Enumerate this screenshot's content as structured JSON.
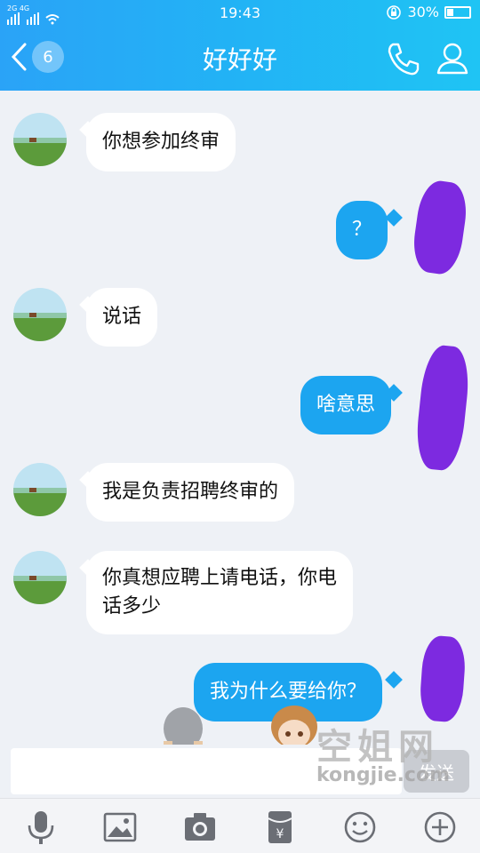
{
  "status": {
    "signal": "2G 4G",
    "time": "19:43",
    "battery": "30%",
    "battery_level": 0.3
  },
  "header": {
    "back_badge": "6",
    "title": "好好好",
    "phone_icon": "phone-icon",
    "profile_icon": "profile-icon"
  },
  "messages": [
    {
      "side": "in",
      "text": "你想参加终审"
    },
    {
      "side": "out",
      "text": "？"
    },
    {
      "side": "in",
      "text": "说话"
    },
    {
      "side": "out",
      "text": "啥意思"
    },
    {
      "side": "in",
      "text": "我是负责招聘终审的"
    },
    {
      "side": "in",
      "text_line1": "你真想应聘上请电话，你电",
      "text_line2": "话多少"
    },
    {
      "side": "out",
      "text": "我为什么要给你？"
    }
  ],
  "composer": {
    "input_value": "",
    "send_label": "发送"
  },
  "toolbar": {
    "icons": [
      "mic-icon",
      "image-icon",
      "camera-icon",
      "red-packet-icon",
      "emoji-icon",
      "plus-icon"
    ]
  },
  "watermark": {
    "line1": "空姐网",
    "line2": "kongjie.com"
  },
  "colors": {
    "header_gradient": [
      "#2aa3f7",
      "#1fc4f4"
    ],
    "outgoing_bubble": "#1ca5f0",
    "incoming_bubble": "#ffffff",
    "redaction": "#7d2ae0"
  }
}
